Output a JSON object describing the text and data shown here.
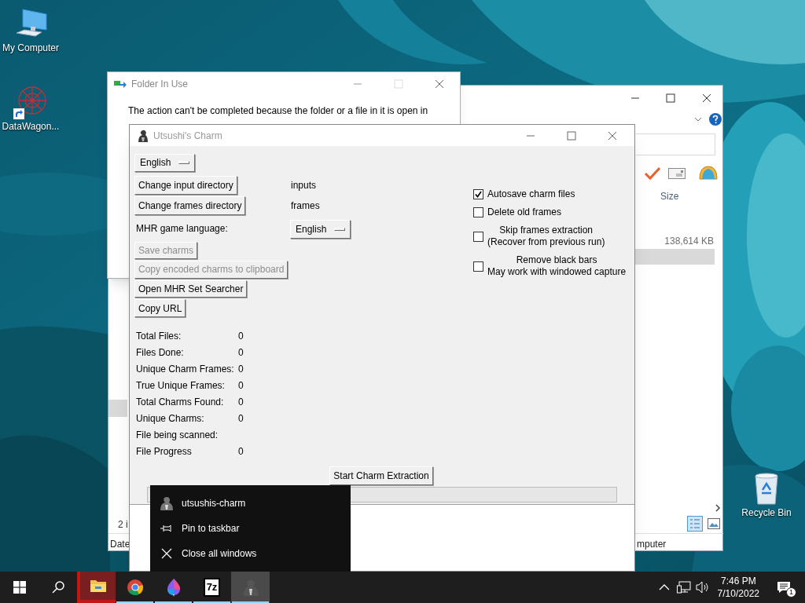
{
  "desktop_icons": [
    {
      "kind": "computer",
      "label": "My Computer"
    },
    {
      "kind": "shortcut",
      "label": "DataWagon..."
    },
    {
      "kind": "recycle",
      "label": "Recycle Bin"
    }
  ],
  "explorer": {
    "size_header": "Size",
    "file_size": "138,614 KB",
    "item_count": "2 i",
    "left_header": "Date",
    "details_fragment": "mputer"
  },
  "folder_dialog": {
    "title": "Folder In Use",
    "message": [
      "The action can't be completed because the folder or a file in it is open in"
    ]
  },
  "app": {
    "title": "Utsushi's Charm",
    "language_menu": "English",
    "directory_rows": [
      {
        "button": "Change input directory",
        "value": "inputs"
      },
      {
        "button": "Change frames directory",
        "value": "frames"
      }
    ],
    "game_language": {
      "label": "MHR game language:",
      "value": "English"
    },
    "actions": [
      {
        "label": "Save charms",
        "disabled": true
      },
      {
        "label": "Copy encoded charms to clipboard",
        "disabled": true
      },
      {
        "label": "Open MHR Set Searcher",
        "disabled": false
      },
      {
        "label": "Copy URL",
        "disabled": false
      }
    ],
    "stats": [
      {
        "label": "Total Files:",
        "value": "0"
      },
      {
        "label": "Files Done:",
        "value": "0"
      },
      {
        "label": "Unique Charm Frames:",
        "value": "0"
      },
      {
        "label": "True Unique Frames:",
        "value": "0"
      },
      {
        "label": "Total Charms Found:",
        "value": "0"
      },
      {
        "label": "Unique Charms:",
        "value": "0"
      },
      {
        "label": "File being scanned:"
      },
      {
        "label": "File Progress",
        "value": "0"
      }
    ],
    "options": [
      {
        "lines": [
          "Autosave charm files"
        ],
        "checked": true
      },
      {
        "lines": [
          "Delete old frames"
        ],
        "checked": false
      },
      {
        "lines": [
          "Skip frames extraction",
          "(Recover from previous run)"
        ],
        "checked": false
      },
      {
        "lines": [
          "Remove black bars",
          "May work with windowed capture"
        ],
        "checked": false
      }
    ],
    "start_button": "Start Charm Extraction",
    "progress": {
      "level": 0
    }
  },
  "jump_list": [
    {
      "kind": "app",
      "label": "utsushis-charm"
    },
    {
      "kind": "pin",
      "label": "Pin to taskbar"
    },
    {
      "kind": "close",
      "label": "Close all windows"
    }
  ],
  "taskbar": {
    "apps": [
      {
        "kind": "explorer",
        "attention": true,
        "running": false,
        "selected": false
      },
      {
        "kind": "chrome",
        "attention": false,
        "running": true,
        "selected": false
      },
      {
        "kind": "paint",
        "attention": false,
        "running": true,
        "selected": false
      },
      {
        "kind": "sevenzip",
        "label": "7z",
        "attention": false,
        "running": true,
        "selected": false
      },
      {
        "kind": "charm",
        "attention": false,
        "running": true,
        "selected": true
      }
    ],
    "time": "7:46 PM",
    "date": "7/10/2022",
    "notification_count": "1"
  }
}
